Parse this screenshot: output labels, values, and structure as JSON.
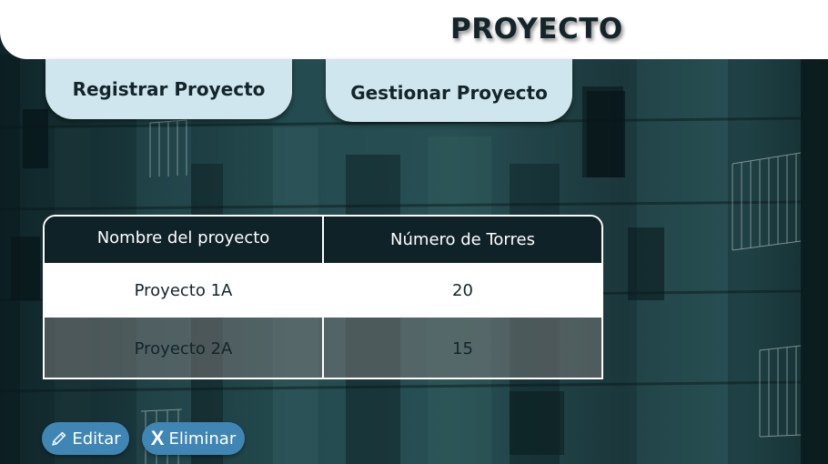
{
  "header": {
    "title": "PROYECTO"
  },
  "tabs": [
    {
      "label": "Registrar Proyecto"
    },
    {
      "label": "Gestionar Proyecto"
    }
  ],
  "table": {
    "columns": [
      "Nombre del proyecto",
      "Número de Torres"
    ],
    "rows": [
      [
        "Proyecto 1A",
        "20"
      ],
      [
        "Proyecto 2A",
        "15"
      ]
    ]
  },
  "actions": {
    "edit_label": "Editar",
    "edit_icon": "pencil-icon",
    "delete_glyph": "X",
    "delete_label": "Eliminar"
  },
  "colors": {
    "header_bg": "#ffffff",
    "tab_bg": "#cfe6ee",
    "table_head_bg": "#0e2228",
    "button_bg": "#3f86b5"
  }
}
